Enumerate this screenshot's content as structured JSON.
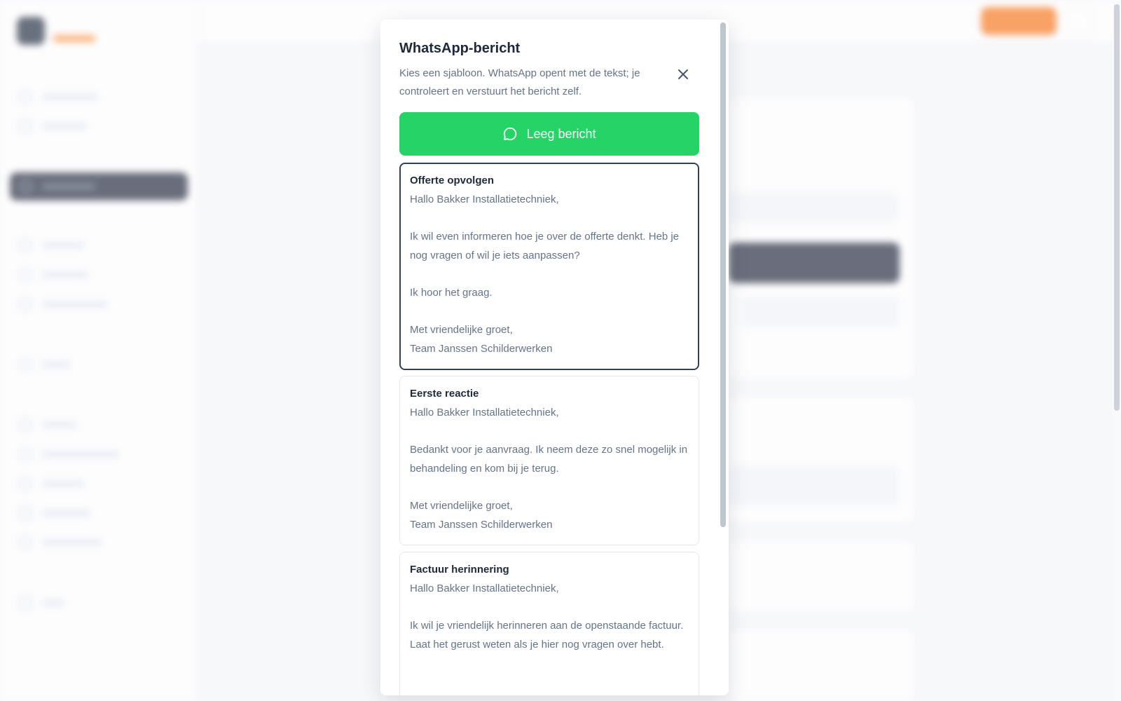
{
  "modal": {
    "title": "WhatsApp-bericht",
    "description": "Kies een sjabloon. WhatsApp opent met de tekst; je controleert en verstuurt het bericht zelf.",
    "empty_button_label": "Leeg bericht",
    "templates": [
      {
        "title": "Offerte opvolgen",
        "body": "Hallo Bakker Installatietechniek,\n\nIk wil even informeren hoe je over de offerte denkt. Heb je nog vragen of wil je iets aanpassen?\n\nIk hoor het graag.\n\nMet vriendelijke groet,\nTeam Janssen Schilderwerken",
        "selected": true
      },
      {
        "title": "Eerste reactie",
        "body": "Hallo Bakker Installatietechniek,\n\nBedankt voor je aanvraag. Ik neem deze zo snel mogelijk in behandeling en kom bij je terug.\n\nMet vriendelijke groet,\nTeam Janssen Schilderwerken",
        "selected": false
      },
      {
        "title": "Factuur herinnering",
        "body": "Hallo Bakker Installatietechniek,\n\nIk wil je vriendelijk herinneren aan de openstaande factuur. Laat het gerust weten als je hier nog vragen over hebt.",
        "selected": false
      }
    ]
  },
  "icons": {
    "close": "close-icon",
    "chat": "chat-bubble-icon"
  },
  "colors": {
    "whatsapp_green": "#25d366",
    "brand_orange": "#f97316",
    "sidebar_active": "#1e2438"
  }
}
